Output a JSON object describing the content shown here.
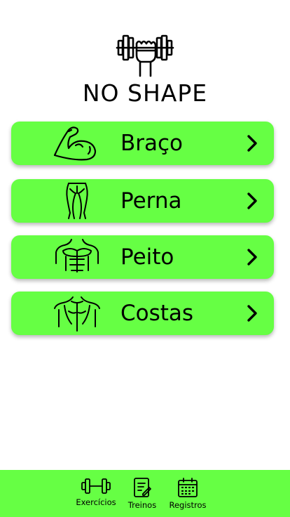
{
  "app": {
    "title": "NO SHAPE",
    "logo_icon": "dumbbell-fist-icon"
  },
  "colors": {
    "accent": "#66ff44",
    "background": "#ffffff",
    "text": "#000000"
  },
  "categories": [
    {
      "label": "Braço",
      "icon": "bicep-icon"
    },
    {
      "label": "Perna",
      "icon": "legs-icon"
    },
    {
      "label": "Peito",
      "icon": "chest-icon"
    },
    {
      "label": "Costas",
      "icon": "back-icon"
    }
  ],
  "bottom_nav": [
    {
      "label": "Exercícios",
      "icon": "dumbbell-icon"
    },
    {
      "label": "Treinos",
      "icon": "notebook-pen-icon"
    },
    {
      "label": "Registros",
      "icon": "calendar-icon"
    }
  ]
}
